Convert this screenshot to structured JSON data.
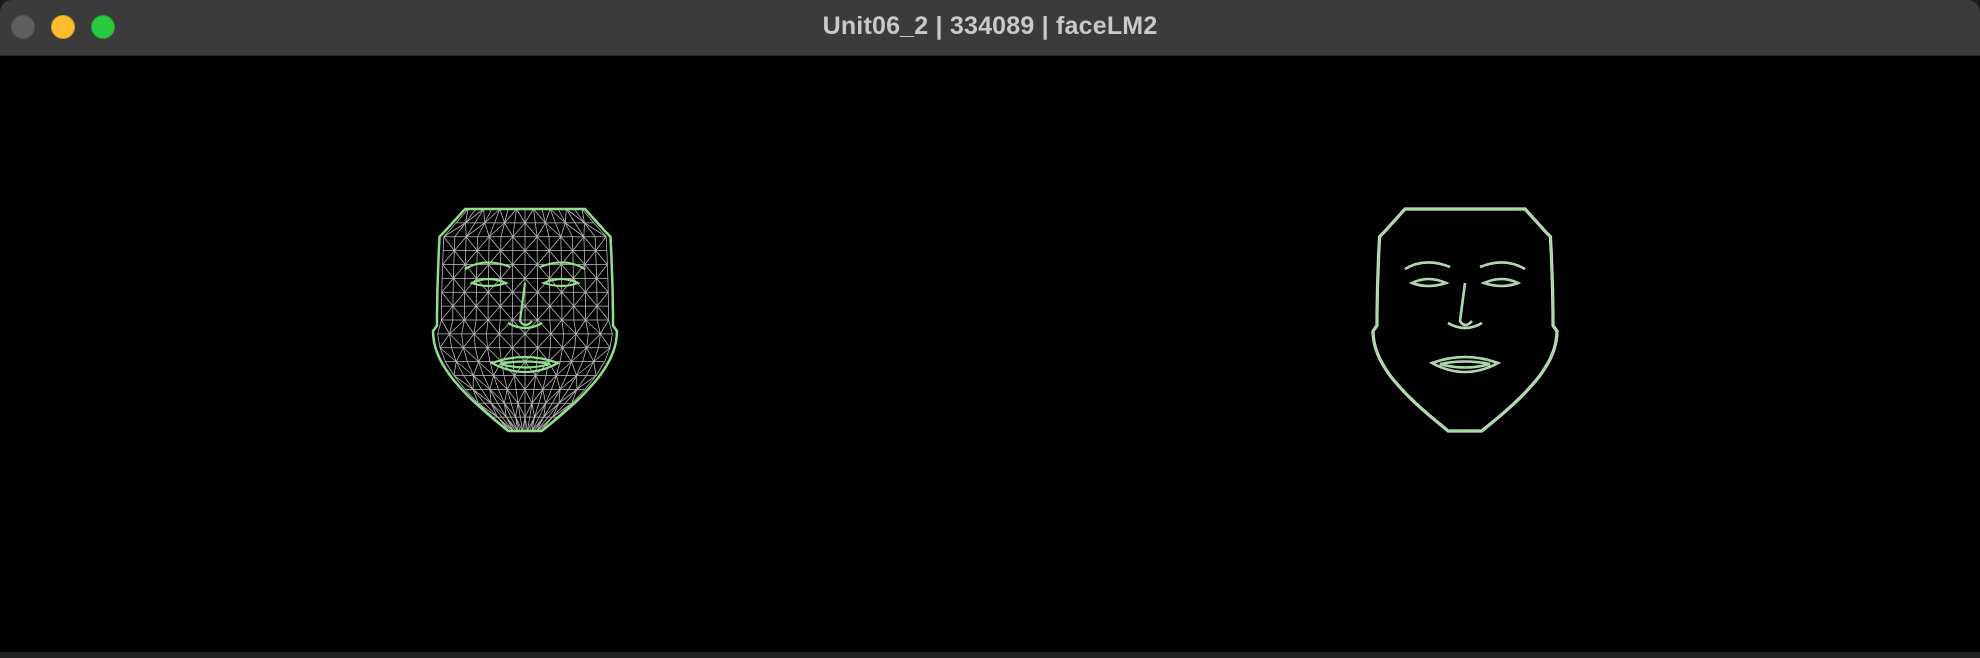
{
  "window": {
    "title": "Unit06_2 | 334089 | faceLM2"
  },
  "traffic_lights": {
    "close_color": "#5f5f5f",
    "minimize_color": "#febc2e",
    "maximize_color": "#28c840"
  },
  "viewer": {
    "background": "#000000",
    "landmark_color": "#8fe08a",
    "mesh_color": "#b9b9b9",
    "faces": [
      {
        "name": "face-mesh-tesselation",
        "style": "triangulated mesh"
      },
      {
        "name": "face-mesh-contours",
        "style": "contours and landmark points"
      }
    ]
  }
}
